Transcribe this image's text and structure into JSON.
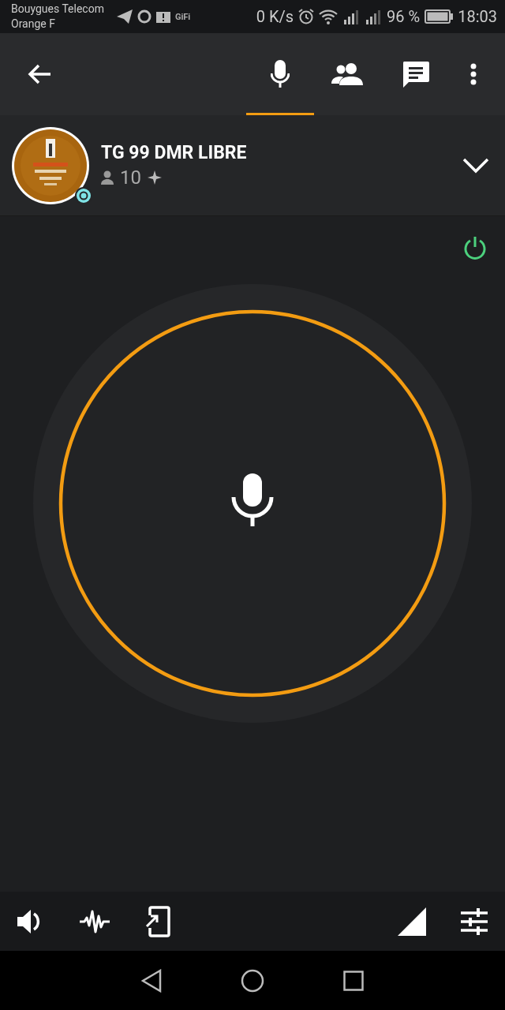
{
  "status_bar": {
    "carriers": [
      "Bouygues Telecom",
      "Orange F"
    ],
    "gifi": "GiFi",
    "speed": "0 K/s",
    "battery": "96 %",
    "time": "18:03"
  },
  "tabs": [
    {
      "kind": "mic",
      "selected": true
    },
    {
      "kind": "people",
      "selected": false
    },
    {
      "kind": "chat",
      "selected": false
    }
  ],
  "channel": {
    "name": "TG 99 DMR LIBRE",
    "members": "10",
    "online": true
  },
  "talk": {
    "power_on": true,
    "ring_active": true
  }
}
